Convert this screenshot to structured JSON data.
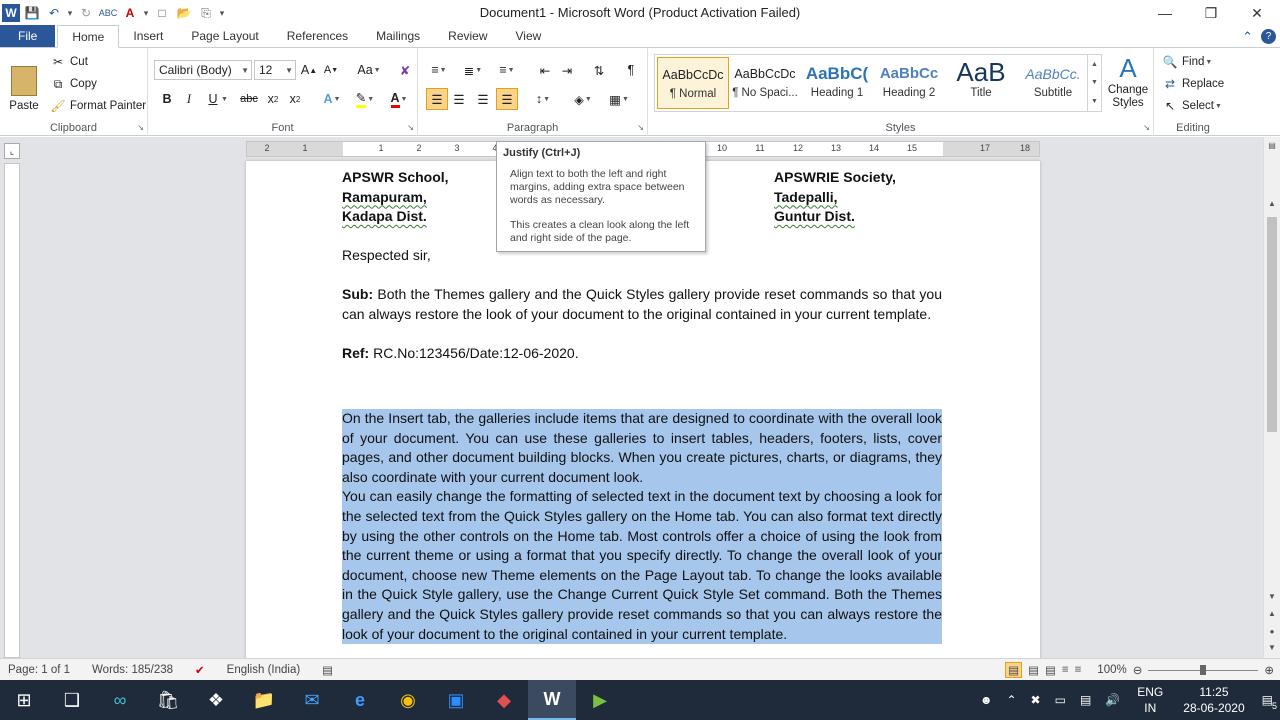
{
  "window": {
    "title": "Document1 - Microsoft Word (Product Activation Failed)"
  },
  "tabs": [
    "File",
    "Home",
    "Insert",
    "Page Layout",
    "References",
    "Mailings",
    "Review",
    "View"
  ],
  "clipboard": {
    "paste": "Paste",
    "cut": "Cut",
    "copy": "Copy",
    "format_painter": "Format Painter",
    "label": "Clipboard"
  },
  "font": {
    "name": "Calibri (Body)",
    "size": "12",
    "label": "Font"
  },
  "paragraph": {
    "label": "Paragraph"
  },
  "styles": {
    "label": "Styles",
    "items": [
      {
        "sample": "AaBbCcDc",
        "name": "¶ Normal"
      },
      {
        "sample": "AaBbCcDc",
        "name": "¶ No Spaci..."
      },
      {
        "sample": "AaBbC(",
        "name": "Heading 1"
      },
      {
        "sample": "AaBbCc",
        "name": "Heading 2"
      },
      {
        "sample": "AaB",
        "name": "Title"
      },
      {
        "sample": "AaBbCc.",
        "name": "Subtitle"
      }
    ],
    "change_styles": "Change Styles"
  },
  "editing": {
    "find": "Find",
    "replace": "Replace",
    "select": "Select",
    "label": "Editing"
  },
  "ruler": {
    "numbers": [
      "2",
      "1",
      "1",
      "2",
      "3",
      "4",
      "5",
      "6",
      "7",
      "8",
      "9",
      "10",
      "11",
      "12",
      "13",
      "14",
      "15",
      "16",
      "17",
      "18"
    ]
  },
  "tooltip": {
    "title": "Justify (Ctrl+J)",
    "body1": "Align text to both the left and right margins, adding extra space between words as necessary.",
    "body2": "This creates a clean look along the left and right side of the page."
  },
  "document": {
    "left_addr": [
      "APSWR School,",
      "Ramapuram,",
      "Kadapa Dist."
    ],
    "right_addr": [
      "APSWRIE Society,",
      "Tadepalli,",
      "Guntur Dist."
    ],
    "salutation": "Respected sir,",
    "sub_label": "Sub:",
    "sub_text": " Both the Themes gallery and the Quick Styles gallery provide reset commands so that you can always restore the look of your document to the original contained in your current template.",
    "ref_label": "Ref:",
    "ref_text": " RC.No:123456/Date:12-06-2020.",
    "para1": "On the Insert tab, the galleries include items that are designed to coordinate with the overall look of your document. You can use these galleries to insert tables, headers, footers, lists, cover pages, and other document building blocks. When you create pictures, charts, or diagrams, they also coordinate with your current document look.",
    "para2": "You can easily change the formatting of selected text in the document text by choosing a look for the selected text from the Quick Styles gallery on the Home tab. You can also format text directly by using the other controls on the Home tab. Most controls offer a choice of using the look from the current theme or using a format that you specify directly. To change the overall look of your document, choose new Theme elements on the Page Layout tab. To change the looks available in the Quick Style gallery, use the Change Current Quick Style Set command. Both the Themes gallery and the Quick Styles gallery provide reset commands so that you can always restore the look of your document to the original contained in your current template."
  },
  "status": {
    "page": "Page: 1 of 1",
    "words": "Words: 185/238",
    "language": "English (India)",
    "zoom": "100%"
  },
  "taskbar": {
    "lang1": "ENG",
    "lang2": "IN",
    "time": "11:25",
    "date": "28-06-2020",
    "notif": "5"
  }
}
